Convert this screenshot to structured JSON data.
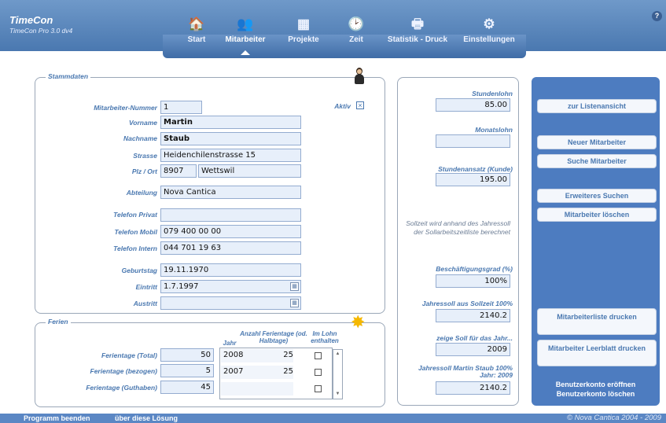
{
  "app": {
    "title": "TimeCon",
    "version": "TimeCon Pro 3.0 dv4",
    "help": "?"
  },
  "nav": [
    {
      "label": "Start",
      "icon": "🏠"
    },
    {
      "label": "Mitarbeiter",
      "icon": "👥"
    },
    {
      "label": "Projekte",
      "icon": "▦"
    },
    {
      "label": "Zeit",
      "icon": "🕑"
    },
    {
      "label": "Statistik - Druck",
      "icon": "🖶"
    },
    {
      "label": "Einstellungen",
      "icon": "⚙"
    }
  ],
  "stamm": {
    "legend": "Stammdaten",
    "labels": {
      "nr": "Mitarbeiter-Nummer",
      "vorname": "Vorname",
      "nachname": "Nachname",
      "strasse": "Strasse",
      "plz": "Plz / Ort",
      "abteilung": "Abteilung",
      "tel_privat": "Telefon Privat",
      "tel_mobil": "Telefon Mobil",
      "tel_intern": "Telefon Intern",
      "geburtstag": "Geburtstag",
      "eintritt": "Eintritt",
      "austritt": "Austritt",
      "aktiv": "Aktiv"
    },
    "values": {
      "nr": "1",
      "vorname": "Martin",
      "nachname": "Staub",
      "strasse": "Heidenchilenstrasse 15",
      "plz": "8907",
      "ort": "Wettswil",
      "abteilung": "Nova Cantica",
      "tel_privat": "",
      "tel_mobil": "079 400 00 00",
      "tel_intern": "044 701 19 63",
      "geburtstag": "19.11.1970",
      "eintritt": "1.7.1997",
      "austritt": ""
    }
  },
  "ferien": {
    "legend": "Ferien",
    "labels": {
      "total": "Ferientage (Total)",
      "bezogen": "Ferientage (bezogen)",
      "guthaben": "Ferientage (Guthaben)"
    },
    "values": {
      "total": "50",
      "bezogen": "5",
      "guthaben": "45"
    },
    "headers": {
      "jahr": "Jahr",
      "anzahl": "Anzahl Ferientage (od. Halbtage)",
      "lohn": "Im Lohn enthalten"
    },
    "rows": [
      {
        "jahr": "2008",
        "tage": "25"
      },
      {
        "jahr": "2007",
        "tage": "25"
      },
      {
        "jahr": "",
        "tage": ""
      }
    ]
  },
  "lohn": {
    "stundenlohn_label": "Stundenlohn",
    "stundenlohn": "85.00",
    "monatslohn_label": "Monatslohn",
    "monatslohn": "",
    "stundenansatz_label": "Stundenansatz (Kunde)",
    "stundenansatz": "195.00",
    "sollzeit_note": "Sollzeit wird anhand des Jahressoll der Sollarbeitszeitliste berechnet",
    "grad_label": "Beschäftigungsgrad (%)",
    "grad": "100%",
    "jahressoll_label": "Jahressoll aus Sollzeit 100%",
    "jahressoll": "2140.2",
    "zeige_label": "zeige Soll für das Jahr...",
    "zeige": "2009",
    "jahressoll_ms_label": "Jahressoll Martin Staub 100% Jahr: 2009",
    "jahressoll_ms": "2140.2"
  },
  "side": {
    "listen": "zur Listenansicht",
    "neu": "Neuer Mitarbeiter",
    "suche": "Suche Mitarbeiter",
    "erweitert": "Erweiteres Suchen",
    "loeschen": "Mitarbeiter löschen",
    "liste_drucken": "Mitarbeiterliste drucken",
    "leerblatt": "Mitarbeiter Leerblatt drucken",
    "konto_oeffnen": "Benutzerkonto eröffnen",
    "konto_loeschen": "Benutzerkonto löschen"
  },
  "footer": {
    "beenden": "Programm beenden",
    "about": "über diese Lösung",
    "copyright": "© Nova Cantica 2004 - 2009"
  }
}
